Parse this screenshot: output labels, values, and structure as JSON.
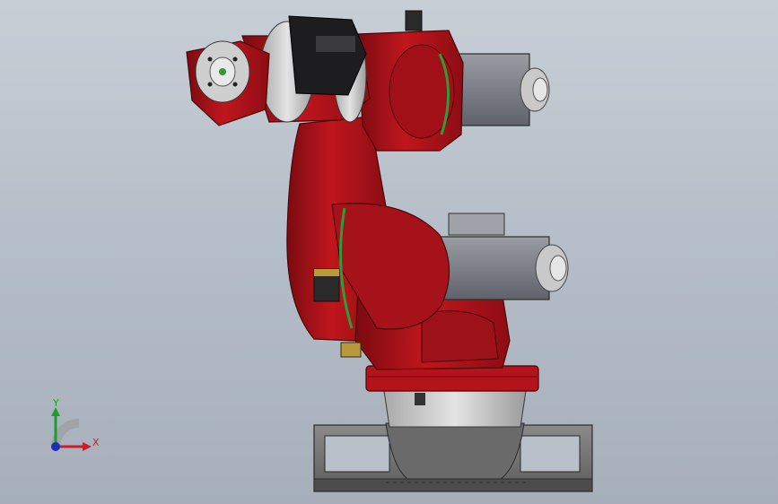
{
  "viewport": {
    "background_top": "#c7ced6",
    "background_bottom": "#a6afba"
  },
  "model": {
    "name": "robot-arm",
    "colors": {
      "body_red": "#b3131a",
      "body_dark": "#6e0a0e",
      "motor_grey": "#7d8089",
      "ring_light": "#d8d8d8",
      "base_grey": "#6f6f6f",
      "cable_green": "#2f9b3a"
    }
  },
  "triad": {
    "y_label": "Y",
    "x_label": "X",
    "y_color": "#1e9e2e",
    "x_color": "#c8202a",
    "z_color": "#1c2fb8"
  }
}
